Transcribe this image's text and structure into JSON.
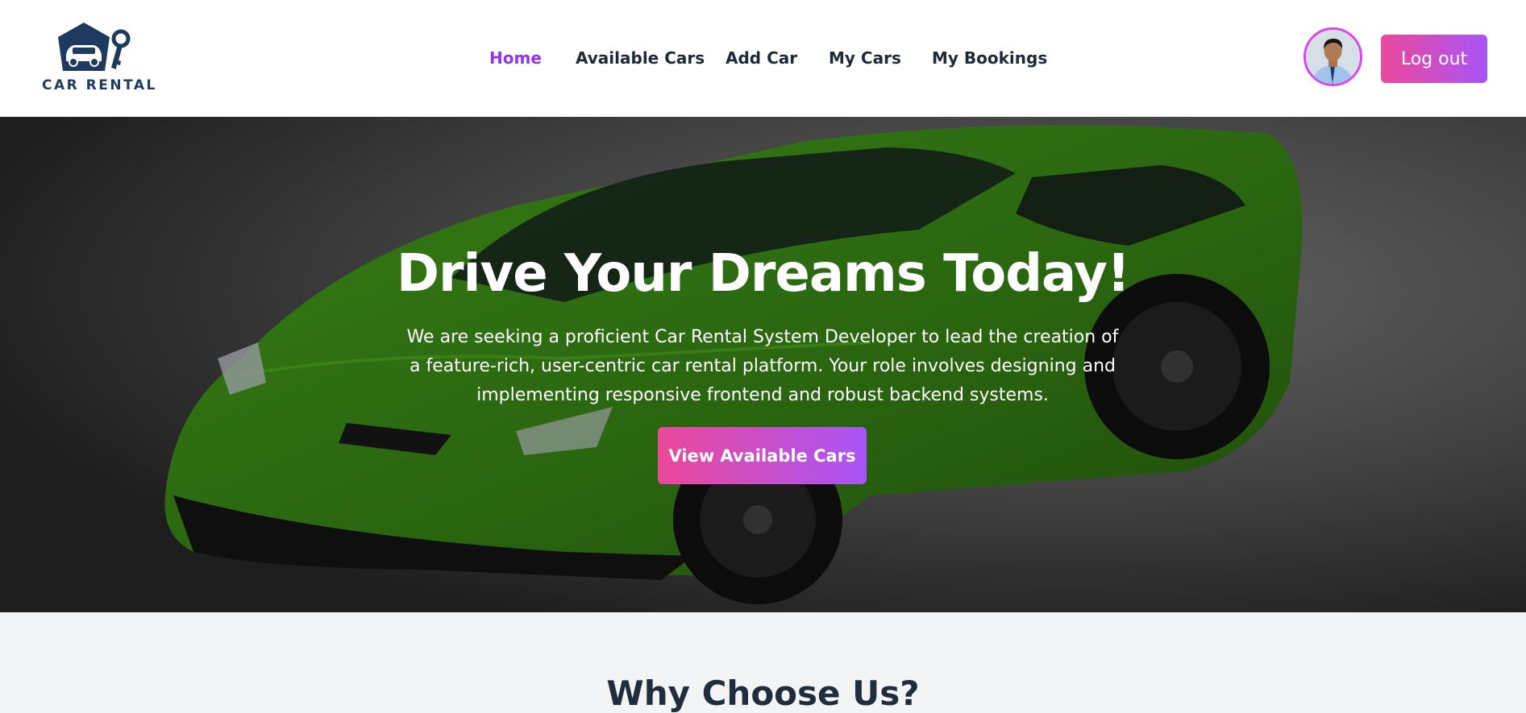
{
  "brand": {
    "name": "CAR RENTAL",
    "primary_color": "#1e3a5f"
  },
  "nav": {
    "items": [
      {
        "label": "Home",
        "active": true
      },
      {
        "label": "Available Cars",
        "active": false
      },
      {
        "label": "Add Car",
        "active": false
      },
      {
        "label": "My Cars",
        "active": false
      },
      {
        "label": "My Bookings",
        "active": false
      }
    ],
    "active_color": "#9333ea",
    "text_color": "#1f2937"
  },
  "user": {
    "avatar_icon": "user-avatar",
    "logout_label": "Log out"
  },
  "hero": {
    "title": "Drive Your Dreams Today!",
    "description": "We are seeking a proficient Car Rental System Developer to lead the creation of a feature-rich, user-centric car rental platform. Your role involves designing and implementing responsive frontend and robust backend systems.",
    "cta_label": "View Available Cars",
    "car_color": "#3a8a1a"
  },
  "why": {
    "title": "Why Choose Us?"
  },
  "accent_gradient": [
    "#ec4899",
    "#a855f7"
  ]
}
